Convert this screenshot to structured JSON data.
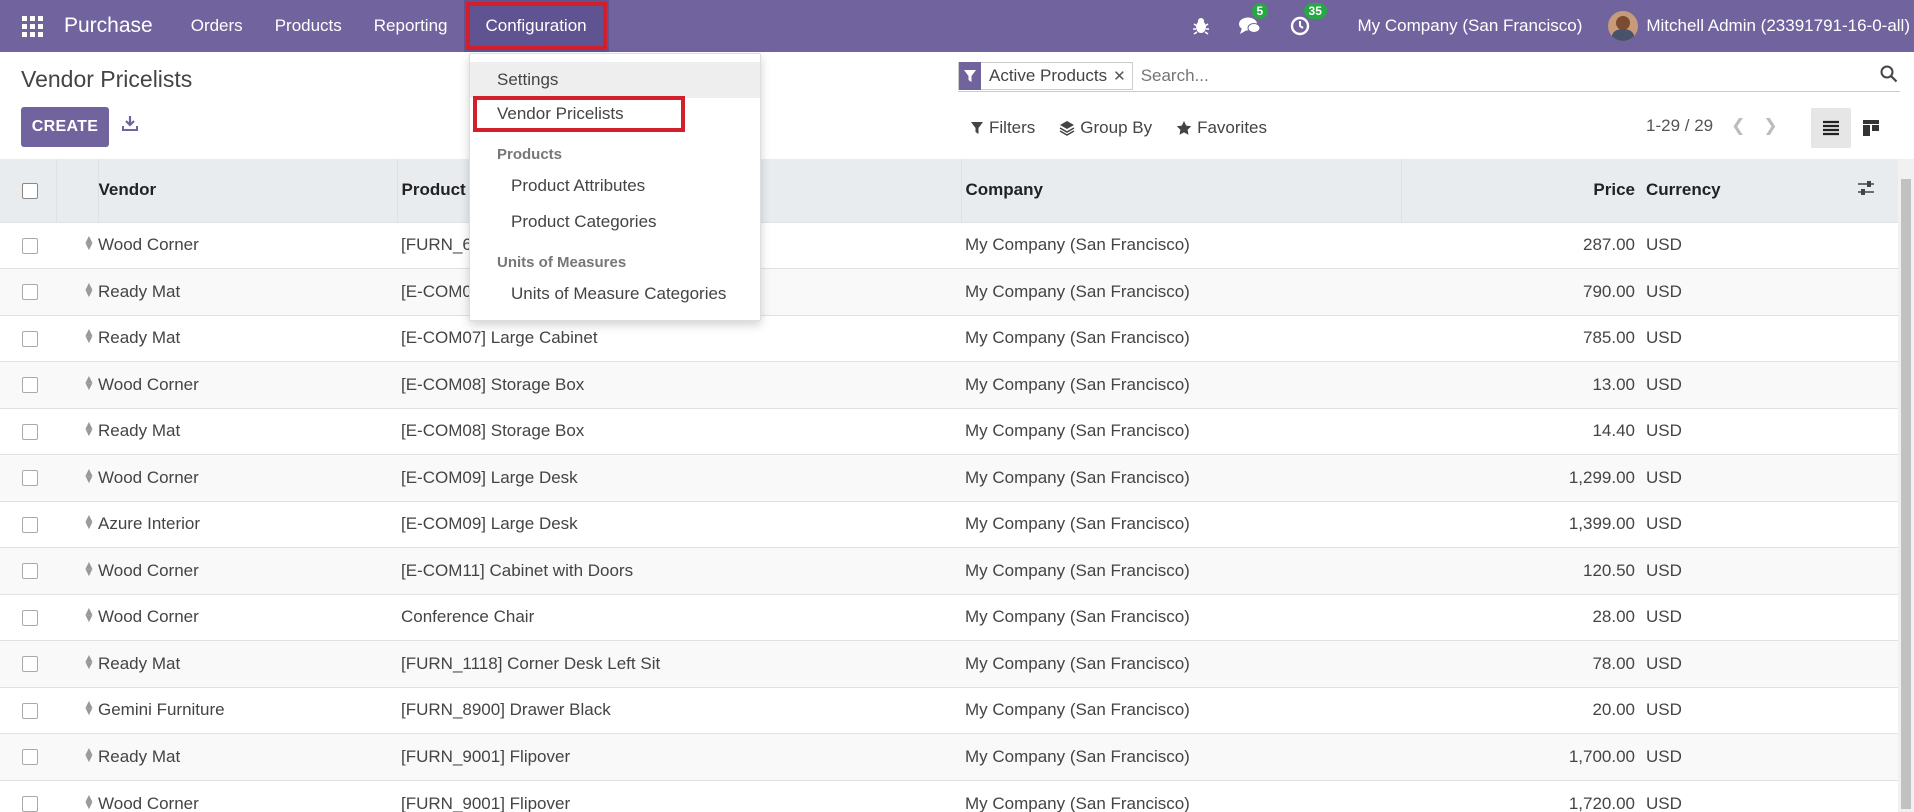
{
  "navbar": {
    "app_name": "Purchase",
    "menu": [
      "Orders",
      "Products",
      "Reporting",
      "Configuration"
    ],
    "messages_count": "5",
    "activities_count": "35",
    "company": "My Company (San Francisco)",
    "user": "Mitchell Admin (23391791-16-0-all)"
  },
  "control_panel": {
    "title": "Vendor Pricelists",
    "create_label": "CREATE",
    "search": {
      "facet": "Active Products",
      "placeholder": "Search..."
    },
    "filters_label": "Filters",
    "group_by_label": "Group By",
    "favorites_label": "Favorites",
    "pager": "1-29 / 29"
  },
  "dropdown": {
    "settings": "Settings",
    "vendor_pricelists": "Vendor Pricelists",
    "products_header": "Products",
    "product_attributes": "Product Attributes",
    "product_categories": "Product Categories",
    "uom_header": "Units of Measures",
    "uom_categories": "Units of Measure Categories"
  },
  "table": {
    "columns": {
      "vendor": "Vendor",
      "product": "Product",
      "company": "Company",
      "price": "Price",
      "currency": "Currency"
    },
    "rows": [
      {
        "vendor": "Wood Corner",
        "product": "[FURN_6",
        "company": "My Company (San Francisco)",
        "price": "287.00",
        "currency": "USD"
      },
      {
        "vendor": "Ready Mat",
        "product": "[E-COM0",
        "company": "My Company (San Francisco)",
        "price": "790.00",
        "currency": "USD"
      },
      {
        "vendor": "Ready Mat",
        "product": "[E-COM07] Large Cabinet",
        "company": "My Company (San Francisco)",
        "price": "785.00",
        "currency": "USD"
      },
      {
        "vendor": "Wood Corner",
        "product": "[E-COM08] Storage Box",
        "company": "My Company (San Francisco)",
        "price": "13.00",
        "currency": "USD"
      },
      {
        "vendor": "Ready Mat",
        "product": "[E-COM08] Storage Box",
        "company": "My Company (San Francisco)",
        "price": "14.40",
        "currency": "USD"
      },
      {
        "vendor": "Wood Corner",
        "product": "[E-COM09] Large Desk",
        "company": "My Company (San Francisco)",
        "price": "1,299.00",
        "currency": "USD"
      },
      {
        "vendor": "Azure Interior",
        "product": "[E-COM09] Large Desk",
        "company": "My Company (San Francisco)",
        "price": "1,399.00",
        "currency": "USD"
      },
      {
        "vendor": "Wood Corner",
        "product": "[E-COM11] Cabinet with Doors",
        "company": "My Company (San Francisco)",
        "price": "120.50",
        "currency": "USD"
      },
      {
        "vendor": "Wood Corner",
        "product": "Conference Chair",
        "company": "My Company (San Francisco)",
        "price": "28.00",
        "currency": "USD"
      },
      {
        "vendor": "Ready Mat",
        "product": "[FURN_1118] Corner Desk Left Sit",
        "company": "My Company (San Francisco)",
        "price": "78.00",
        "currency": "USD"
      },
      {
        "vendor": "Gemini Furniture",
        "product": "[FURN_8900] Drawer Black",
        "company": "My Company (San Francisco)",
        "price": "20.00",
        "currency": "USD"
      },
      {
        "vendor": "Ready Mat",
        "product": "[FURN_9001] Flipover",
        "company": "My Company (San Francisco)",
        "price": "1,700.00",
        "currency": "USD"
      },
      {
        "vendor": "Wood Corner",
        "product": "[FURN_9001] Flipover",
        "company": "My Company (San Francisco)",
        "price": "1,720.00",
        "currency": "USD"
      }
    ]
  },
  "colors": {
    "brand": "#71639e",
    "highlight": "#d31f2c",
    "badge": "#28a745"
  }
}
